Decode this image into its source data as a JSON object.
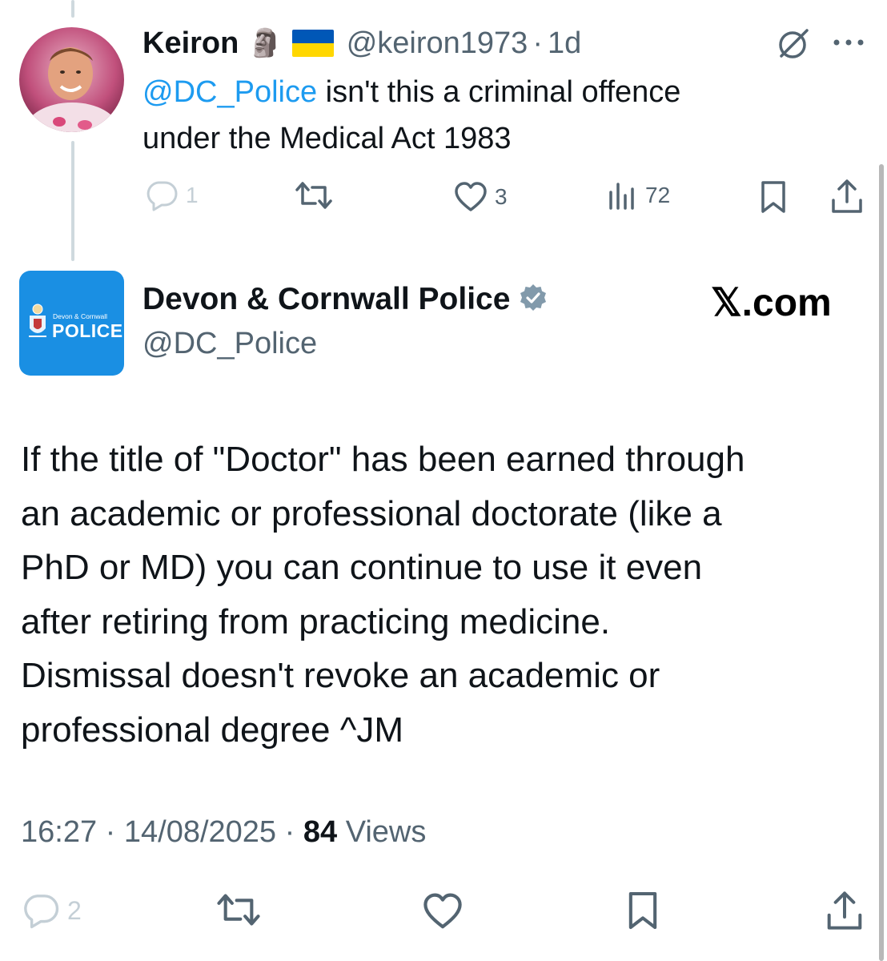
{
  "reply": {
    "display_name": "Keiron",
    "name_emojis": [
      "🗿",
      "🇺🇦"
    ],
    "handle": "@keiron1973",
    "separator": "·",
    "time_ago": "1d",
    "text_mention": "@DC_Police",
    "text_rest_line1": " isn't this a criminal offence",
    "text_line2": "under the Medical Act 1983",
    "actions": {
      "reply_count": "1",
      "like_count": "3",
      "views_count": "72"
    }
  },
  "main_tweet": {
    "display_name": "Devon & Cornwall Police",
    "handle": "@DC_Police",
    "watermark": "𝕏.com",
    "logo_text_small": "Devon & Cornwall",
    "logo_text_big": "POLICE",
    "body_lines": [
      "If the title of \"Doctor\" has been earned through",
      "an academic or professional doctorate (like a",
      "PhD or MD) you can continue to use it even",
      "after retiring from practicing medicine.",
      "Dismissal doesn't revoke an academic or",
      "professional degree ^JM"
    ],
    "time": "16:27",
    "date": "14/08/2025",
    "separator": "·",
    "views_count": "84",
    "views_label": "Views",
    "actions": {
      "reply_count": "2"
    }
  },
  "colors": {
    "accent": "#1d9bf0",
    "muted": "#536471",
    "verified_badge": "#829aab",
    "police_blue": "#1a8fe3"
  }
}
